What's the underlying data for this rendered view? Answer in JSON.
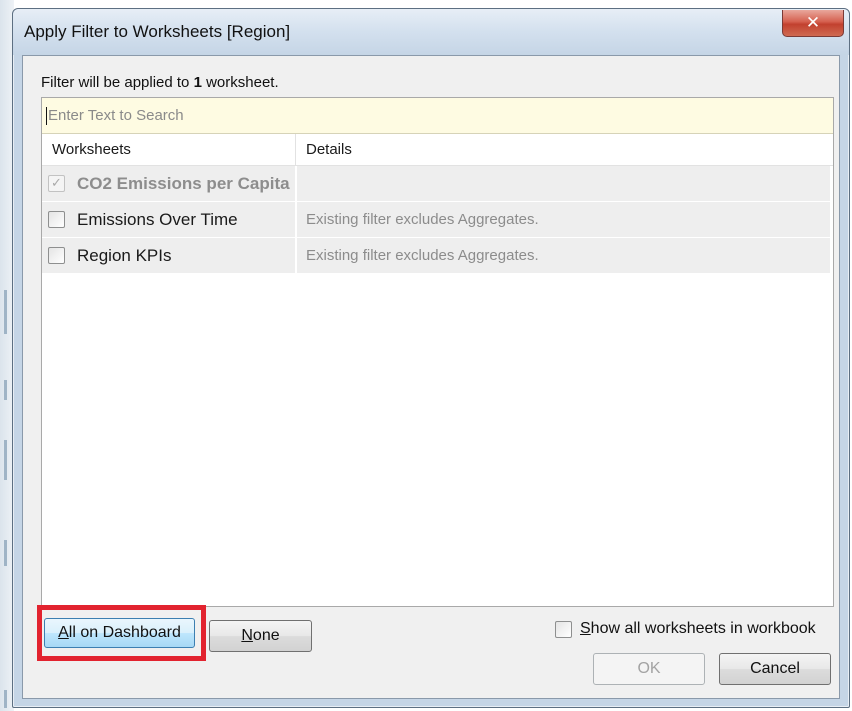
{
  "window": {
    "title": "Apply Filter to Worksheets [Region]",
    "close_glyph": "✕"
  },
  "info": {
    "prefix": "Filter will be applied to ",
    "count": "1",
    "suffix": " worksheet."
  },
  "search": {
    "placeholder": "Enter Text to Search",
    "value": ""
  },
  "table": {
    "columns": [
      "Worksheets",
      "Details"
    ],
    "rows": [
      {
        "label": "CO2 Emissions per Capita",
        "details": "",
        "checked": true,
        "disabled": true
      },
      {
        "label": "Emissions Over Time",
        "details": "Existing filter excludes Aggregates.",
        "checked": false,
        "disabled": false
      },
      {
        "label": "Region KPIs",
        "details": "Existing filter excludes Aggregates.",
        "checked": false,
        "disabled": false
      }
    ]
  },
  "buttons": {
    "all_on_dashboard_access": "A",
    "all_on_dashboard_rest": "ll on Dashboard",
    "none_access": "N",
    "none_rest": "one",
    "ok": "OK",
    "cancel": "Cancel"
  },
  "show_all": {
    "access": "S",
    "rest": "how all worksheets in workbook",
    "checked": false
  },
  "colors": {
    "highlight": "#e2232f",
    "search_bg": "#fefbe2",
    "row_bg": "#eeeeee"
  },
  "icons": {
    "checkbox_checked_disabled": "checkmark-icon",
    "close": "close-icon"
  }
}
